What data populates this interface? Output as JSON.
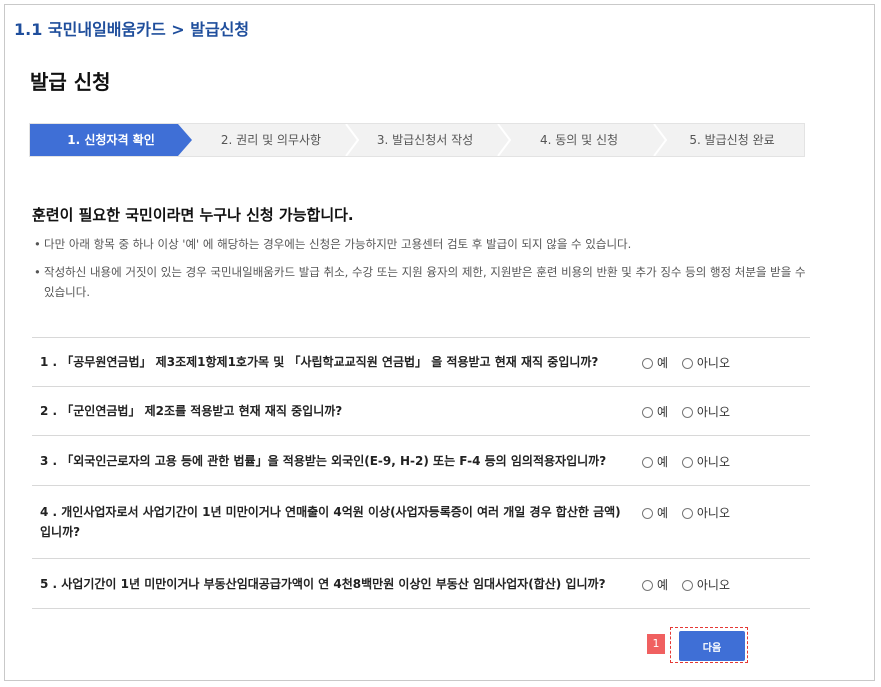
{
  "breadcrumb": "1.1 국민내일배움카드 > 발급신청",
  "page_title": "발급 신청",
  "steps": [
    {
      "label": "1. 신청자격 확인",
      "active": true
    },
    {
      "label": "2. 권리 및 의무사항",
      "active": false
    },
    {
      "label": "3. 발급신청서 작성",
      "active": false
    },
    {
      "label": "4. 동의 및 신청",
      "active": false
    },
    {
      "label": "5. 발급신청 완료",
      "active": false
    }
  ],
  "intro": {
    "heading": "훈련이 필요한 국민이라면 누구나 신청 가능합니다.",
    "notes": [
      "다만 아래 항목 중 하나 이상 '예' 에 해당하는 경우에는 신청은 가능하지만 고용센터 검토 후 발급이 되지 않을 수 있습니다.",
      "작성하신 내용에 거짓이 있는 경우 국민내일배움카드 발급 취소, 수강 또는 지원 융자의 제한, 지원받은 훈련 비용의 반환 및 추가 징수 등의 행정 처분을 받을 수 있습니다."
    ]
  },
  "questions": [
    {
      "text": "1 . 「공무원연금법」 제3조제1항제1호가목 및 「사립학교교직원 연금법」 을 적용받고 현재 재직 중입니까?",
      "yes": "예",
      "no": "아니오"
    },
    {
      "text": "2 . 「군인연금법」 제2조를 적용받고 현재 재직 중입니까?",
      "yes": "예",
      "no": "아니오"
    },
    {
      "text": "3 . 「외국인근로자의 고용 등에 관한 법률」을 적용받는 외국인(E-9, H-2) 또는 F-4 등의 임의적용자입니까?",
      "yes": "예",
      "no": "아니오"
    },
    {
      "text": "4 . 개인사업자로서 사업기간이 1년 미만이거나 연매출이 4억원 이상(사업자등록증이 여러 개일 경우 합산한 금액) 입니까?",
      "yes": "예",
      "no": "아니오"
    },
    {
      "text": "5 . 사업기간이 1년 미만이거나 부동산임대공급가액이 연 4천8백만원 이상인 부동산 임대사업자(합산) 입니까?",
      "yes": "예",
      "no": "아니오"
    }
  ],
  "next_button": "다음",
  "marker": "1",
  "colors": {
    "accent": "#3f6fd6",
    "breadcrumb": "#1f4e9c",
    "marker": "#f06060"
  }
}
